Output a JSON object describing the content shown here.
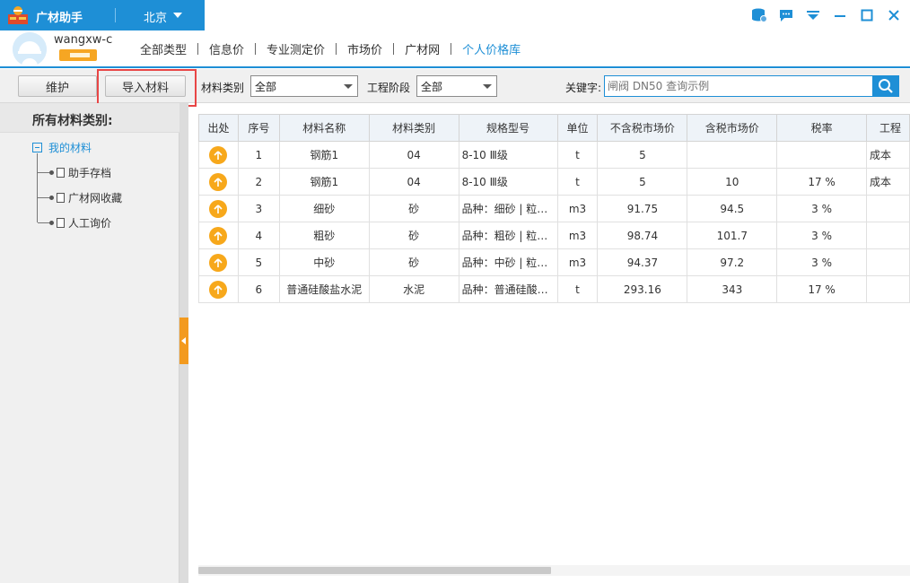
{
  "app": {
    "title": "广材助手",
    "city": "北京"
  },
  "user": {
    "name": "wangxw-c"
  },
  "nav": {
    "items": [
      {
        "label": "全部类型"
      },
      {
        "label": "信息价"
      },
      {
        "label": "专业测定价"
      },
      {
        "label": "市场价"
      },
      {
        "label": "广材网"
      },
      {
        "label": "个人价格库",
        "active": true
      }
    ]
  },
  "toolbar": {
    "maintain_label": "维护",
    "import_label": "导入材料",
    "category_label": "材料类别",
    "category_value": "全部",
    "stage_label": "工程阶段",
    "stage_value": "全部",
    "keyword_label": "关键字:",
    "search_placeholder": "闸阀 DN50 查询示例"
  },
  "sidebar": {
    "title": "所有材料类别:",
    "root": "我的材料",
    "children": [
      {
        "label": "助手存档"
      },
      {
        "label": "广材网收藏"
      },
      {
        "label": "人工询价"
      }
    ]
  },
  "table": {
    "headers": [
      "出处",
      "序号",
      "材料名称",
      "材料类别",
      "规格型号",
      "单位",
      "不含税市场价",
      "含税市场价",
      "税率",
      "工程"
    ],
    "rows": [
      {
        "no": "1",
        "name": "钢筋1",
        "category": "04",
        "spec": "8-10 Ⅲ级",
        "unit": "t",
        "price_ex": "5",
        "price_in": "",
        "tax": "",
        "project": "成本"
      },
      {
        "no": "2",
        "name": "钢筋1",
        "category": "04",
        "spec": "8-10 Ⅲ级",
        "unit": "t",
        "price_ex": "5",
        "price_in": "10",
        "tax": "17 %",
        "project": "成本"
      },
      {
        "no": "3",
        "name": "细砂",
        "category": "砂",
        "spec": "品种：细砂 | 粒…",
        "unit": "m3",
        "price_ex": "91.75",
        "price_in": "94.5",
        "tax": "3 %",
        "project": ""
      },
      {
        "no": "4",
        "name": "粗砂",
        "category": "砂",
        "spec": "品种：粗砂 | 粒…",
        "unit": "m3",
        "price_ex": "98.74",
        "price_in": "101.7",
        "tax": "3 %",
        "project": ""
      },
      {
        "no": "5",
        "name": "中砂",
        "category": "砂",
        "spec": "品种：中砂 | 粒…",
        "unit": "m3",
        "price_ex": "94.37",
        "price_in": "97.2",
        "tax": "3 %",
        "project": ""
      },
      {
        "no": "6",
        "name": "普通硅酸盐水泥",
        "category": "水泥",
        "spec": "品种：普通硅酸…",
        "unit": "t",
        "price_ex": "293.16",
        "price_in": "343",
        "tax": "17 %",
        "project": ""
      }
    ]
  },
  "icons": {
    "source": "up-arrow-icon",
    "search": "search-icon"
  },
  "colors": {
    "brand": "#1e8fd6",
    "accent": "#f7a81b",
    "highlight": "#e84646"
  }
}
